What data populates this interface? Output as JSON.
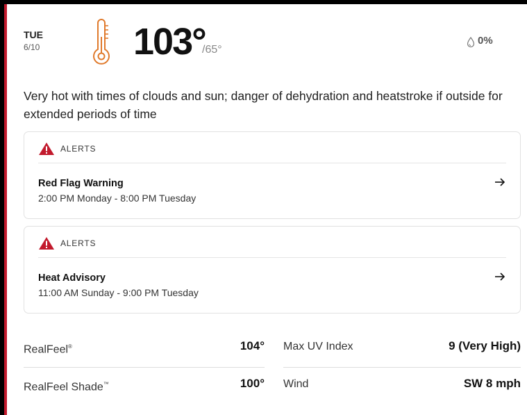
{
  "day": {
    "weekday": "TUE",
    "date": "6/10",
    "high": "103°",
    "low": "/65°",
    "precip": "0%",
    "phrase": "Very hot with times of clouds and sun; danger of dehydration and heatstroke if outside for extended periods of time"
  },
  "icons": {
    "thermometer": "thermometer-icon",
    "precip": "droplet-icon",
    "alert": "warning-triangle-icon",
    "arrow": "arrow-right-icon"
  },
  "colors": {
    "accent": "#c21a2d",
    "warning": "#c21a2d"
  },
  "alerts": [
    {
      "label": "ALERTS",
      "title": "Red Flag Warning",
      "time": "2:00 PM Monday - 8:00 PM Tuesday"
    },
    {
      "label": "ALERTS",
      "title": "Heat Advisory",
      "time": "11:00 AM Sunday - 9:00 PM Tuesday"
    }
  ],
  "details": {
    "realfeel": {
      "label": "RealFeel",
      "mark": "®",
      "value": "104°"
    },
    "realfeel_shade": {
      "label": "RealFeel Shade",
      "mark": "™",
      "value": "100°"
    },
    "uv": {
      "label": "Max UV Index",
      "value": "9 (Very High)"
    },
    "wind": {
      "label": "Wind",
      "value": "SW 8 mph"
    }
  }
}
